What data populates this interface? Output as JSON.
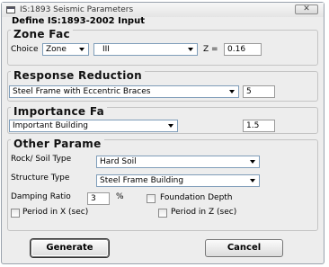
{
  "window": {
    "title": "IS:1893 Seismic Parameters"
  },
  "heading": "Define IS:1893-2002 Input",
  "zone": {
    "title": "Zone Fac",
    "choice_label": "Choice",
    "choice_value": "Zone",
    "zone_value": "III",
    "z_label": "Z =",
    "z_value": "0.16"
  },
  "response": {
    "title": "Response Reduction",
    "system_value": "Steel Frame with Eccentric Braces",
    "r_value": "5"
  },
  "importance": {
    "title": "Importance Fa",
    "category_value": "Important Building",
    "i_value": "1.5"
  },
  "other": {
    "title": "Other Parame",
    "soil_label": "Rock/ Soil Type",
    "soil_value": "Hard Soil",
    "structure_label": "Structure Type",
    "structure_value": "Steel Frame Building",
    "damping_label": "Damping Ratio",
    "damping_value": "3",
    "damping_unit": "%",
    "foundation_label": "Foundation Depth",
    "period_x_label": "Period in X (sec)",
    "period_z_label": "Period in Z (sec)"
  },
  "buttons": {
    "generate": "Generate",
    "cancel": "Cancel"
  }
}
